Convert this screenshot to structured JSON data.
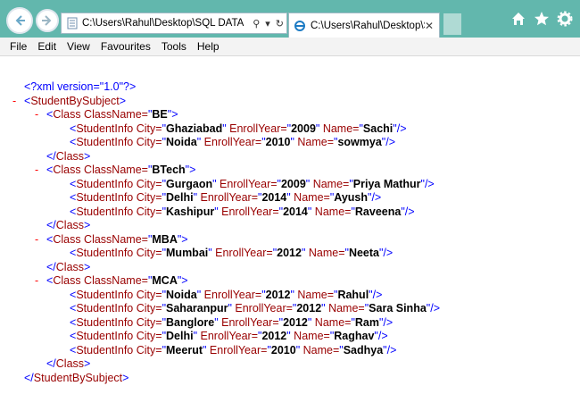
{
  "browser": {
    "address": "C:\\Users\\Rahul\\Desktop\\SQL DATA",
    "tab_title": "C:\\Users\\Rahul\\Desktop\\S...",
    "menu": [
      "File",
      "Edit",
      "View",
      "Favourites",
      "Tools",
      "Help"
    ],
    "titlebar_color": "#62b7ad"
  },
  "xml": {
    "declaration": "<?xml version=\"1.0\"?>",
    "root": "StudentBySubject",
    "classes": [
      {
        "name": "BE",
        "students": [
          {
            "City": "Ghaziabad",
            "EnrollYear": "2009",
            "Name": "Sachi"
          },
          {
            "City": "Noida",
            "EnrollYear": "2010",
            "Name": "sowmya"
          }
        ]
      },
      {
        "name": "BTech",
        "students": [
          {
            "City": "Gurgaon",
            "EnrollYear": "2009",
            "Name": "Priya Mathur"
          },
          {
            "City": "Delhi",
            "EnrollYear": "2014",
            "Name": "Ayush"
          },
          {
            "City": "Kashipur",
            "EnrollYear": "2014",
            "Name": "Raveena"
          }
        ]
      },
      {
        "name": "MBA",
        "students": [
          {
            "City": "Mumbai",
            "EnrollYear": "2012",
            "Name": "Neeta"
          }
        ]
      },
      {
        "name": "MCA",
        "students": [
          {
            "City": "Noida",
            "EnrollYear": "2012",
            "Name": "Rahul"
          },
          {
            "City": "Saharanpur",
            "EnrollYear": "2012",
            "Name": "Sara Sinha"
          },
          {
            "City": "Banglore",
            "EnrollYear": "2012",
            "Name": "Ram"
          },
          {
            "City": "Delhi",
            "EnrollYear": "2012",
            "Name": "Raghav"
          },
          {
            "City": "Meerut",
            "EnrollYear": "2010",
            "Name": "Sadhya"
          }
        ]
      }
    ]
  }
}
